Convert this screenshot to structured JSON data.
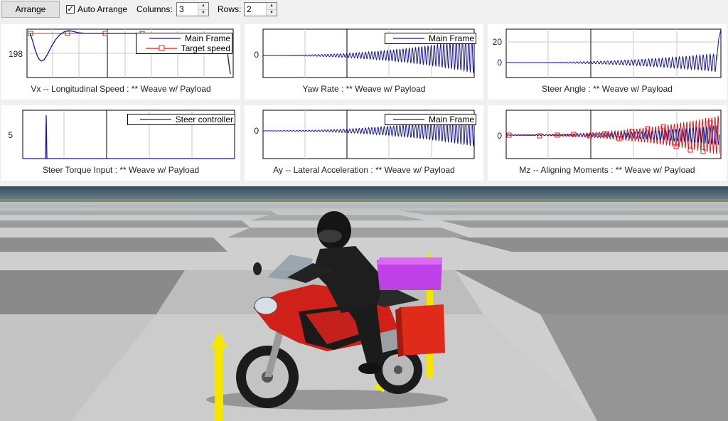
{
  "toolbar": {
    "arrange_label": "Arrange",
    "auto_arrange_label": "Auto Arrange",
    "auto_arrange_checked": true,
    "columns_label": "Columns:",
    "columns_value": "3",
    "rows_label": "Rows:",
    "rows_value": "2"
  },
  "colors": {
    "main_frame": "#1a1a8c",
    "target_speed": "#d42020",
    "grid": "#c8c8c8"
  },
  "plots": [
    {
      "title": "Vx -- Longitudinal Speed : ** Weave w/ Payload",
      "ytick": "198",
      "legend": [
        {
          "label": "Main Frame",
          "icon": "line"
        },
        {
          "label": "Target speed",
          "icon": "square-marker"
        }
      ]
    },
    {
      "title": "Yaw Rate : ** Weave w/ Payload",
      "ytick": "0",
      "legend": [
        {
          "label": "Main Frame",
          "icon": "line"
        }
      ]
    },
    {
      "title": "Steer Angle : ** Weave w/ Payload",
      "yticks": [
        "20",
        "0"
      ],
      "legend": []
    },
    {
      "title": "Steer Torque Input : ** Weave w/ Payload",
      "ytick": "5",
      "legend": [
        {
          "label": "Steer controller",
          "icon": "line"
        }
      ]
    },
    {
      "title": "Ay -- Lateral Acceleration : ** Weave w/ Payload",
      "ytick": "0",
      "legend": [
        {
          "label": "Main Frame",
          "icon": "line"
        }
      ]
    },
    {
      "title": "Mz -- Aligning Moments : ** Weave w/ Payload",
      "ytick": "0",
      "legend": []
    }
  ]
}
